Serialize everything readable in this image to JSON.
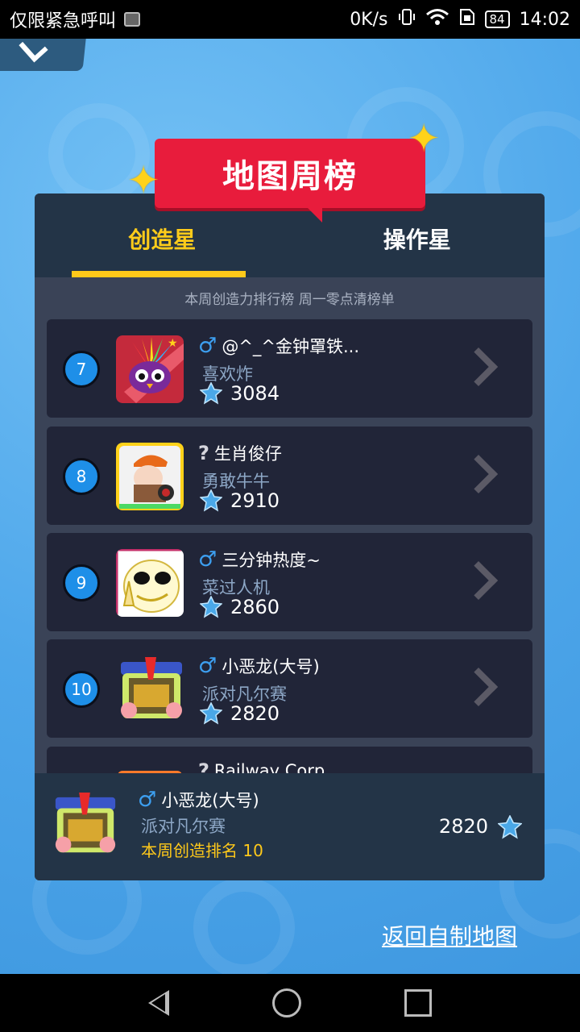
{
  "status_bar": {
    "left_text": "仅限紧急呼叫",
    "speed": "0K/s",
    "battery": "84",
    "time": "14:02"
  },
  "banner": {
    "title": "地图周榜"
  },
  "tabs": [
    {
      "label": "创造星",
      "active": true
    },
    {
      "label": "操作星",
      "active": false
    }
  ],
  "subtitle": "本周创造力排行榜 周一零点清榜单",
  "rows": [
    {
      "rank": "7",
      "gender": "♂",
      "name": "@^_^金钟罩铁...",
      "map": "喜欢炸",
      "score": "3084"
    },
    {
      "rank": "8",
      "gender": "?",
      "name": "生肖俊仔",
      "map": "勇敢牛牛",
      "score": "2910"
    },
    {
      "rank": "9",
      "gender": "♂",
      "name": "三分钟热度~",
      "map": "菜过人机",
      "score": "2860"
    },
    {
      "rank": "10",
      "gender": "♂",
      "name": "小恶龙(大号)",
      "map": "派对凡尔赛",
      "score": "2820"
    },
    {
      "rank": "",
      "gender": "?",
      "name": "Railway Corp",
      "map": "",
      "score": ""
    }
  ],
  "me": {
    "gender": "♂",
    "name": "小恶龙(大号)",
    "map": "派对凡尔赛",
    "rank_text": "本周创造排名 10",
    "score": "2820"
  },
  "return_link": "返回自制地图",
  "colors": {
    "accent": "#ffc91a",
    "banner": "#e81c3c",
    "rank_badge": "#1e8fe8",
    "background": "#52a9ea"
  }
}
